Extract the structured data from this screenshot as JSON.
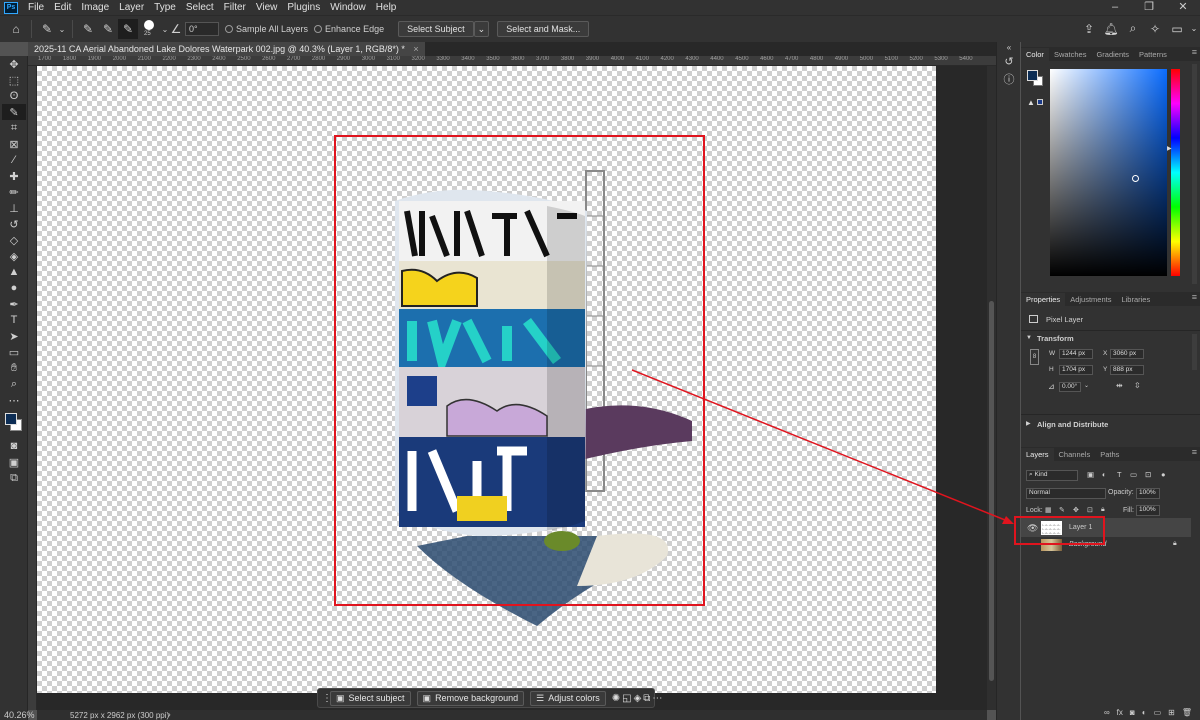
{
  "app": {
    "name": "Ps"
  },
  "menu": [
    "File",
    "Edit",
    "Image",
    "Layer",
    "Type",
    "Select",
    "Filter",
    "View",
    "Plugins",
    "Window",
    "Help"
  ],
  "options": {
    "brush_size": "25",
    "angle": "0°",
    "sample_all_layers": "Sample All Layers",
    "enhance_edge": "Enhance Edge",
    "select_subject": "Select Subject",
    "select_and_mask": "Select and Mask..."
  },
  "document": {
    "tab_title": "2025-11 CA Aerial Abandoned Lake Dolores Waterpark 002.jpg @ 40.3% (Layer 1, RGB/8*) *",
    "close": "×"
  },
  "ruler": [
    "1700",
    "1800",
    "1900",
    "2000",
    "2100",
    "2200",
    "2300",
    "2400",
    "2500",
    "2600",
    "2700",
    "2800",
    "2900",
    "3000",
    "3100",
    "3200",
    "3300",
    "3400",
    "3500",
    "3600",
    "3700",
    "3800",
    "3900",
    "4000",
    "4100",
    "4200",
    "4300",
    "4400",
    "4500",
    "4600",
    "4700",
    "4800",
    "4900",
    "5000",
    "5100",
    "5200",
    "5300",
    "5400"
  ],
  "status": {
    "zoom": "40.26%",
    "info": "5272 px x 2962 px (300 ppi)"
  },
  "context_bar": {
    "select_subject": "Select subject",
    "remove_background": "Remove background",
    "adjust_colors": "Adjust colors"
  },
  "color_panel": {
    "tabs": [
      "Color",
      "Swatches",
      "Gradients",
      "Patterns"
    ],
    "fg_color": "#0c2d55",
    "bg_color": "#ffffff"
  },
  "properties": {
    "tabs": [
      "Properties",
      "Adjustments",
      "Libraries"
    ],
    "type": "Pixel Layer",
    "transform_title": "Transform",
    "w_label": "W",
    "w": "1244 px",
    "h_label": "H",
    "h": "1704 px",
    "x_label": "X",
    "x": "3060 px",
    "y_label": "Y",
    "y": "888 px",
    "angle": "0.00°",
    "align_title": "Align and Distribute"
  },
  "layers": {
    "tabs": [
      "Layers",
      "Channels",
      "Paths"
    ],
    "filter": "Kind",
    "blend_mode": "Normal",
    "opacity_label": "Opacity:",
    "opacity": "100%",
    "lock_label": "Lock:",
    "fill_label": "Fill:",
    "fill": "100%",
    "items": [
      {
        "name": "Layer 1"
      },
      {
        "name": "Background"
      }
    ]
  },
  "annotation_color": "#e0141e"
}
